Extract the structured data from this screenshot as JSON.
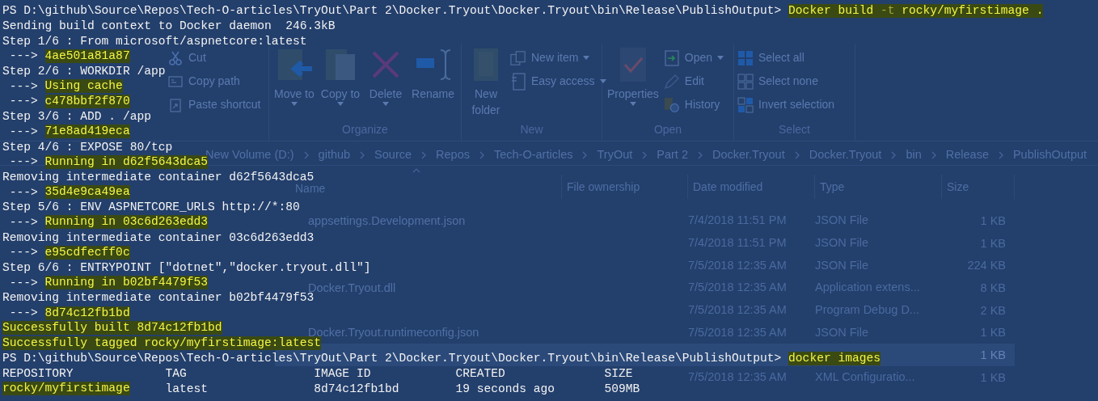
{
  "explorer": {
    "ribbon": {
      "groups": [
        {
          "small_buttons": [
            {
              "label": "Cut"
            },
            {
              "label": "Copy path"
            },
            {
              "label": "Paste shortcut"
            }
          ]
        },
        {
          "label": "Organize",
          "large_buttons": [
            {
              "label": "Move to",
              "dropdown": true
            },
            {
              "label": "Copy to",
              "dropdown": true
            },
            {
              "label": "Delete",
              "dropdown": true
            },
            {
              "label": "Rename",
              "dropdown": false
            }
          ]
        },
        {
          "label": "New",
          "large_buttons": [
            {
              "label": "New folder",
              "dropdown": false
            }
          ],
          "small_buttons": [
            {
              "label": "New item",
              "dropdown": true
            },
            {
              "label": "Easy access",
              "dropdown": true
            }
          ]
        },
        {
          "label": "Open",
          "large_buttons": [
            {
              "label": "Properties",
              "dropdown": true
            }
          ],
          "small_buttons": [
            {
              "label": "Open",
              "dropdown": true
            },
            {
              "label": "Edit",
              "dropdown": false
            },
            {
              "label": "History",
              "dropdown": false
            }
          ]
        },
        {
          "label": "Select",
          "small_buttons": [
            {
              "label": "Select all",
              "dropdown": false
            },
            {
              "label": "Select none",
              "dropdown": false
            },
            {
              "label": "Invert selection",
              "dropdown": false
            }
          ]
        }
      ]
    },
    "breadcrumb": [
      "New Volume (D:)",
      "github",
      "Source",
      "Repos",
      "Tech-O-articles",
      "TryOut",
      "Part 2",
      "Docker.Tryout",
      "Docker.Tryout",
      "bin",
      "Release",
      "PublishOutput"
    ],
    "columns": [
      "Name",
      "File ownership",
      "Date modified",
      "Type",
      "Size"
    ],
    "files": [
      {
        "name": "appsettings.Development.json",
        "date_modified": "7/4/2018 11:51 PM",
        "type": "JSON File",
        "size": "1 KB",
        "selected": false
      },
      {
        "date_modified": "7/4/2018 11:51 PM",
        "type": "JSON File",
        "size": "1 KB",
        "selected": false
      },
      {
        "date_modified": "7/5/2018 12:35 AM",
        "type": "JSON File",
        "size": "224 KB",
        "selected": false
      },
      {
        "name": "Docker.Tryout.dll",
        "date_modified": "7/5/2018 12:35 AM",
        "type": "Application extens...",
        "size": "8 KB",
        "selected": false
      },
      {
        "date_modified": "7/5/2018 12:35 AM",
        "type": "Program Debug D...",
        "size": "2 KB",
        "selected": false
      },
      {
        "name": "Docker.Tryout.runtimeconfig.json",
        "date_modified": "7/5/2018 12:35 AM",
        "type": "JSON File",
        "size": "1 KB",
        "selected": false
      },
      {
        "size": "1 KB",
        "selected": true
      },
      {
        "date_modified": "7/5/2018 12:35 AM",
        "type": "XML Configuratio...",
        "size": "1 KB",
        "selected": false
      }
    ]
  },
  "terminal": {
    "lines": [
      {
        "segments": [
          {
            "text": "PS D:\\github\\Source\\Repos\\Tech-O-articles\\TryOut\\Part 2\\Docker.Tryout\\Docker.Tryout\\bin\\Release\\PublishOutput> ",
            "highlighted": false
          },
          {
            "text": "Docker build ",
            "highlighted": true
          },
          {
            "text": "-t",
            "highlighted": true,
            "dim": true
          },
          {
            "text": " rocky/myfirstimage .",
            "highlighted": true
          }
        ]
      },
      {
        "segments": [
          {
            "text": "Sending build context to Docker daemon  246.3kB",
            "highlighted": false
          }
        ]
      },
      {
        "segments": [
          {
            "text": "Step 1/6 : From microsoft/aspnetcore:latest",
            "highlighted": false
          }
        ]
      },
      {
        "segments": [
          {
            "text": " ---> ",
            "highlighted": false
          },
          {
            "text": "4ae501a81a87",
            "highlighted": true
          }
        ]
      },
      {
        "segments": [
          {
            "text": "Step 2/6 : WORKDIR /app",
            "highlighted": false
          }
        ]
      },
      {
        "segments": [
          {
            "text": " ---> ",
            "highlighted": false
          },
          {
            "text": "Using cache",
            "highlighted": true
          }
        ]
      },
      {
        "segments": [
          {
            "text": " ---> ",
            "highlighted": false
          },
          {
            "text": "c478bbf2f870",
            "highlighted": true
          }
        ]
      },
      {
        "segments": [
          {
            "text": "Step 3/6 : ADD . /app",
            "highlighted": false
          }
        ]
      },
      {
        "segments": [
          {
            "text": " ---> ",
            "highlighted": false
          },
          {
            "text": "71e8ad419eca",
            "highlighted": true
          }
        ]
      },
      {
        "segments": [
          {
            "text": "Step 4/6 : EXPOSE 80/tcp",
            "highlighted": false
          }
        ]
      },
      {
        "segments": [
          {
            "text": " ---> ",
            "highlighted": false
          },
          {
            "text": "Running in d62f5643dca5",
            "highlighted": true
          }
        ]
      },
      {
        "segments": [
          {
            "text": "Removing intermediate container d62f5643dca5",
            "highlighted": false
          }
        ]
      },
      {
        "segments": [
          {
            "text": " ---> ",
            "highlighted": false
          },
          {
            "text": "35d4e9ca49ea",
            "highlighted": true
          }
        ]
      },
      {
        "segments": [
          {
            "text": "Step 5/6 : ENV ASPNETCORE_URLS http://*:80",
            "highlighted": false
          }
        ]
      },
      {
        "segments": [
          {
            "text": " ---> ",
            "highlighted": false
          },
          {
            "text": "Running in 03c6d263edd3",
            "highlighted": true
          }
        ]
      },
      {
        "segments": [
          {
            "text": "Removing intermediate container 03c6d263edd3",
            "highlighted": false
          }
        ]
      },
      {
        "segments": [
          {
            "text": " ---> ",
            "highlighted": false
          },
          {
            "text": "e95cdfecff0c",
            "highlighted": true
          }
        ]
      },
      {
        "segments": [
          {
            "text": "Step 6/6 : ENTRYPOINT [\"dotnet\",\"docker.tryout.dll\"]",
            "highlighted": false
          }
        ]
      },
      {
        "segments": [
          {
            "text": " ---> ",
            "highlighted": false
          },
          {
            "text": "Running in b02bf4479f53",
            "highlighted": true
          }
        ]
      },
      {
        "segments": [
          {
            "text": "Removing intermediate container b02bf4479f53",
            "highlighted": false
          }
        ]
      },
      {
        "segments": [
          {
            "text": " ---> ",
            "highlighted": false
          },
          {
            "text": "8d74c12fb1bd",
            "highlighted": true
          }
        ]
      },
      {
        "segments": [
          {
            "text": "Successfully built 8d74c12fb1bd",
            "highlighted": true
          }
        ]
      },
      {
        "segments": [
          {
            "text": "Successfully tagged rocky/myfirstimage:latest",
            "highlighted": true
          }
        ]
      },
      {
        "segments": [
          {
            "text": "PS D:\\github\\Source\\Repos\\Tech-O-articles\\TryOut\\Part 2\\Docker.Tryout\\Docker.Tryout\\bin\\Release\\PublishOutput> ",
            "highlighted": false
          },
          {
            "text": "docker images",
            "highlighted": true
          }
        ]
      },
      {
        "segments": [
          {
            "text": "REPOSITORY             TAG                  IMAGE ID            CREATED              SIZE",
            "highlighted": false
          }
        ]
      },
      {
        "segments": [
          {
            "text": "rocky/myfirstimage",
            "highlighted": true
          },
          {
            "text": "     latest               8d74c12fb1bd        19 seconds ago       509MB",
            "highlighted": false
          }
        ]
      }
    ]
  }
}
